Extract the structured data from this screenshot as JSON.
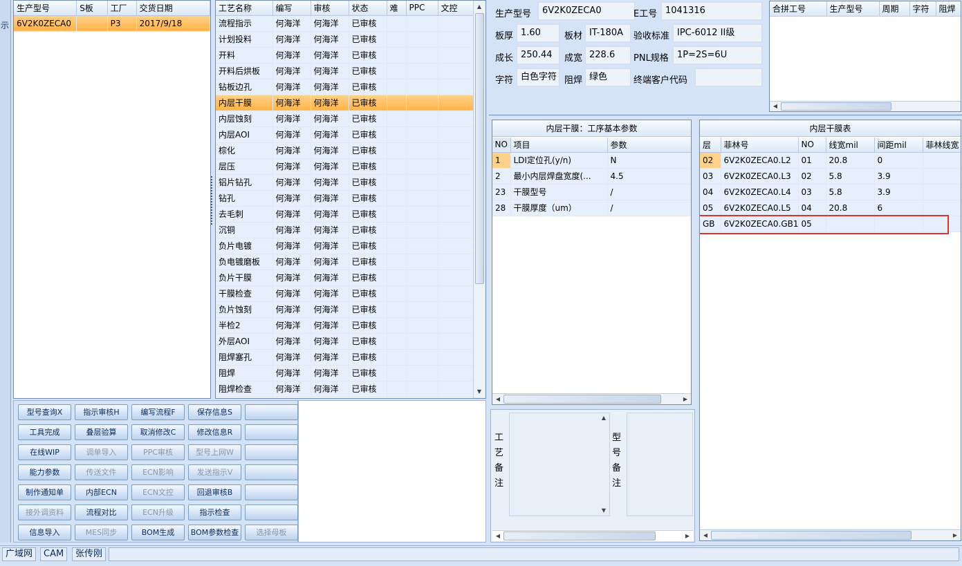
{
  "left_edge_char": "示",
  "order_grid": {
    "headers": [
      "生产型号",
      "S板",
      "工厂",
      "交货日期"
    ],
    "rows": [
      [
        "6V2K0ZECA0",
        "",
        "P3",
        "2017/9/18"
      ]
    ]
  },
  "process_grid": {
    "headers": [
      "工艺名称",
      "编写",
      "审核",
      "状态",
      "难",
      "PPC",
      "文控"
    ],
    "rows": [
      [
        "流程指示",
        "何海洋",
        "何海洋",
        "已审核",
        "",
        "",
        ""
      ],
      [
        "计划投料",
        "何海洋",
        "何海洋",
        "已审核",
        "",
        "",
        ""
      ],
      [
        "开料",
        "何海洋",
        "何海洋",
        "已审核",
        "",
        "",
        ""
      ],
      [
        "开料后烘板",
        "何海洋",
        "何海洋",
        "已审核",
        "",
        "",
        ""
      ],
      [
        "钻板边孔",
        "何海洋",
        "何海洋",
        "已审核",
        "",
        "",
        ""
      ],
      [
        "内层干膜",
        "何海洋",
        "何海洋",
        "已审核",
        "",
        "",
        ""
      ],
      [
        "内层蚀刻",
        "何海洋",
        "何海洋",
        "已审核",
        "",
        "",
        ""
      ],
      [
        "内层AOI",
        "何海洋",
        "何海洋",
        "已审核",
        "",
        "",
        ""
      ],
      [
        "棕化",
        "何海洋",
        "何海洋",
        "已审核",
        "",
        "",
        ""
      ],
      [
        "层压",
        "何海洋",
        "何海洋",
        "已审核",
        "",
        "",
        ""
      ],
      [
        "铝片钻孔",
        "何海洋",
        "何海洋",
        "已审核",
        "",
        "",
        ""
      ],
      [
        "钻孔",
        "何海洋",
        "何海洋",
        "已审核",
        "",
        "",
        ""
      ],
      [
        "去毛刺",
        "何海洋",
        "何海洋",
        "已审核",
        "",
        "",
        ""
      ],
      [
        "沉铜",
        "何海洋",
        "何海洋",
        "已审核",
        "",
        "",
        ""
      ],
      [
        "负片电镀",
        "何海洋",
        "何海洋",
        "已审核",
        "",
        "",
        ""
      ],
      [
        "负电镀磨板",
        "何海洋",
        "何海洋",
        "已审核",
        "",
        "",
        ""
      ],
      [
        "负片干膜",
        "何海洋",
        "何海洋",
        "已审核",
        "",
        "",
        ""
      ],
      [
        "干膜检查",
        "何海洋",
        "何海洋",
        "已审核",
        "",
        "",
        ""
      ],
      [
        "负片蚀刻",
        "何海洋",
        "何海洋",
        "已审核",
        "",
        "",
        ""
      ],
      [
        "半检2",
        "何海洋",
        "何海洋",
        "已审核",
        "",
        "",
        ""
      ],
      [
        "外层AOI",
        "何海洋",
        "何海洋",
        "已审核",
        "",
        "",
        ""
      ],
      [
        "阻焊塞孔",
        "何海洋",
        "何海洋",
        "已审核",
        "",
        "",
        ""
      ],
      [
        "阻焊",
        "何海洋",
        "何海洋",
        "已审核",
        "",
        "",
        ""
      ],
      [
        "阻焊检查",
        "何海洋",
        "何海洋",
        "已审核",
        "",
        "",
        ""
      ]
    ],
    "selected_index": 5
  },
  "info": {
    "model_label": "生产型号",
    "model_value": "6V2K0ZECA0",
    "eno_label": "E工号",
    "eno_value": "1041316",
    "thickness_label": "板厚",
    "thickness_value": "1.60",
    "material_label": "板材",
    "material_value": "IT-180A",
    "standard_label": "验收标准",
    "standard_value": "IPC-6012 II级",
    "length_label": "成长",
    "length_value": "250.44",
    "width_label": "成宽",
    "width_value": "228.6",
    "pnl_label": "PNL规格",
    "pnl_value": "1P=2S=6U",
    "char_label": "字符",
    "char_value": "白色字符",
    "mask_label": "阻焊",
    "mask_value": "绿色",
    "customer_label": "终端客户代码",
    "customer_value": ""
  },
  "combine_grid": {
    "headers": [
      "合拼工号",
      "生产型号",
      "周期",
      "字符",
      "阻焊"
    ]
  },
  "param_panel": {
    "title": "内层干膜：工序基本参数",
    "headers": [
      "NO",
      "项目",
      "参数"
    ],
    "rows": [
      [
        "1",
        "LDI定位孔(y/n)",
        "N"
      ],
      [
        "2",
        "最小内层焊盘宽度(...",
        "4.5"
      ],
      [
        "23",
        "干膜型号",
        "/"
      ],
      [
        "28",
        "干膜厚度（um）",
        "/"
      ]
    ]
  },
  "film_panel": {
    "title": "内层干膜表",
    "headers": [
      "层",
      "菲林号",
      "NO",
      "线宽mil",
      "间距mil",
      "菲林线宽"
    ],
    "rows": [
      [
        "02",
        "6V2K0ZECA0.L2",
        "01",
        "20.8",
        "0",
        ""
      ],
      [
        "03",
        "6V2K0ZECA0.L3",
        "02",
        "5.8",
        "3.9",
        ""
      ],
      [
        "04",
        "6V2K0ZECA0.L4",
        "03",
        "5.8",
        "3.9",
        ""
      ],
      [
        "05",
        "6V2K0ZECA0.L5",
        "04",
        "20.8",
        "6",
        ""
      ],
      [
        "GB",
        "6V2K0ZECA0.GB1",
        "05",
        "",
        "",
        ""
      ]
    ],
    "highlight_color": "#e03030"
  },
  "remarks": {
    "process_label": "工艺备注",
    "model_label": "型号备注"
  },
  "buttons": [
    [
      "型号查询X",
      "指示审核H",
      "编写流程F",
      "保存信息S",
      ""
    ],
    [
      "工具完成",
      "叠层验算",
      "取消修改C",
      "修改信息R",
      ""
    ],
    [
      "在线WIP",
      "调单导入",
      "PPC审核",
      "型号上网W",
      ""
    ],
    [
      "能力参数",
      "传送文件",
      "ECN影响",
      "发送指示V",
      ""
    ],
    [
      "制作通知单",
      "内部ECN",
      "ECN文控",
      "回退审核B",
      ""
    ],
    [
      "接外调资料",
      "流程对比",
      "ECN升级",
      "指示检查",
      ""
    ],
    [
      "信息导入",
      "MES同步",
      "BOM生成",
      "BOM参数检查",
      "选择母板"
    ]
  ],
  "disabled_buttons": [
    "调单导入",
    "PPC审核",
    "型号上网W",
    "传送文件",
    "ECN影响",
    "发送指示V",
    "ECN文控",
    "接外调资料",
    "ECN升级",
    "MES同步",
    "选择母板"
  ],
  "status_bar": [
    "广域网",
    "CAM",
    "张传刚"
  ]
}
